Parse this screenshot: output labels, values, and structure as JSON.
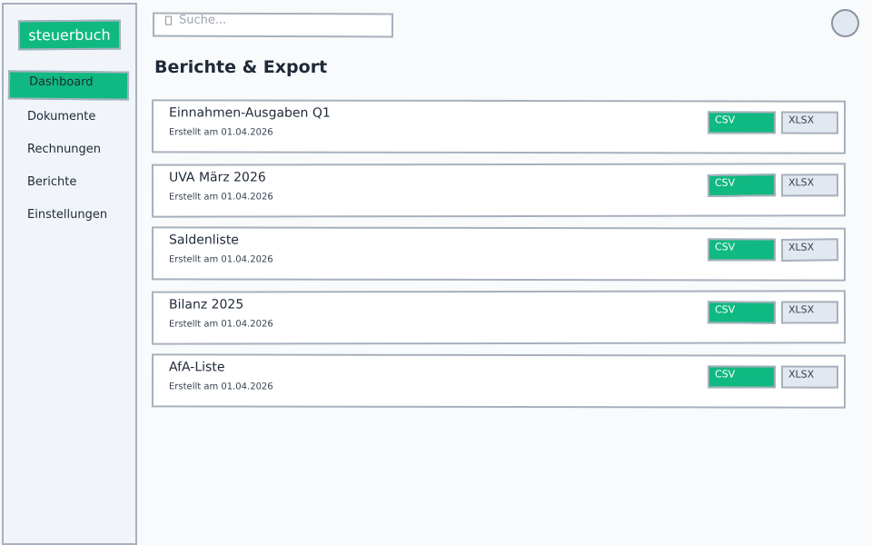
{
  "app": {
    "brand": "steuerbuch"
  },
  "sidebar": {
    "items": [
      {
        "label": "Dashboard"
      },
      {
        "label": "Dokumente"
      },
      {
        "label": "Rechnungen"
      },
      {
        "label": "Berichte"
      },
      {
        "label": "Einstellungen"
      }
    ]
  },
  "search": {
    "placeholder": "Suche..."
  },
  "main": {
    "title": "Berichte & Export",
    "reports": [
      {
        "name": "Einnahmen-Ausgaben Q1",
        "created": "Erstellt am 01.04.2026",
        "csv_label": "CSV",
        "xlsx_label": "XLSX"
      },
      {
        "name": "UVA März 2026",
        "created": "Erstellt am 01.04.2026",
        "csv_label": "CSV",
        "xlsx_label": "XLSX"
      },
      {
        "name": "Saldenliste",
        "created": "Erstellt am 01.04.2026",
        "csv_label": "CSV",
        "xlsx_label": "XLSX"
      },
      {
        "name": "Bilanz 2025",
        "created": "Erstellt am 01.04.2026",
        "csv_label": "CSV",
        "xlsx_label": "XLSX"
      },
      {
        "name": "AfA-Liste",
        "created": "Erstellt am 01.04.2026",
        "csv_label": "CSV",
        "xlsx_label": "XLSX"
      }
    ]
  },
  "colors": {
    "accent": "#10b981",
    "border": "#a7b0bd",
    "sidebar_bg": "#f1f5f9",
    "page_bg": "#f8fafc",
    "secondary_button_bg": "#e2e8f0"
  },
  "icons": {
    "search": "search-icon",
    "avatar": "user-avatar"
  }
}
